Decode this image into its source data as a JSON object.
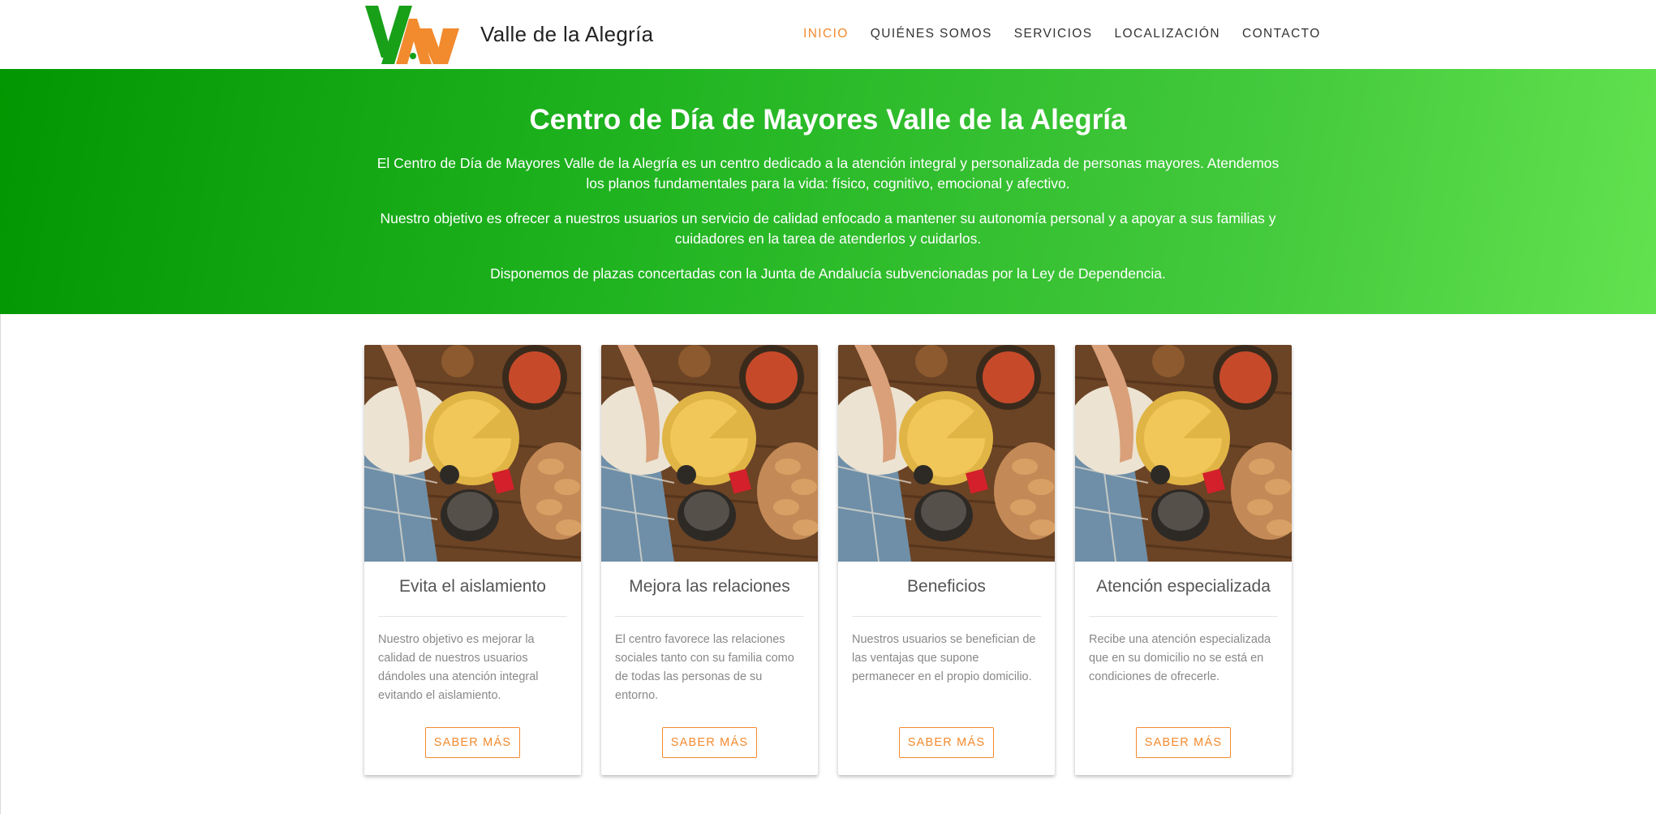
{
  "header": {
    "brand": "Valle de la Alegría",
    "logo_icon": "valle-alegria-va-logo",
    "nav": [
      "INICIO",
      "QUIÉNES SOMOS",
      "SERVICIOS",
      "LOCALIZACIÓN",
      "CONTACTO"
    ],
    "active_nav": "INICIO"
  },
  "hero": {
    "title": "Centro de Día de Mayores Valle de la Alegría",
    "p1": "El Centro de Día de Mayores Valle de la Alegría es un centro dedicado a la atención integral y personalizada de personas mayores. Atendemos los planos fundamentales para la vida: físico, cognitivo, emocional y afectivo.",
    "p2": "Nuestro objetivo es ofrecer a nuestros usuarios un servicio de calidad enfocado a mantener su autonomía personal y a apoyar a sus familias y cuidadores en la tarea de atenderlos y cuidarlos.",
    "p3": "Disponemos de plazas concertadas con la Junta de Andalucía subvencionadas por la Ley de Dependencia."
  },
  "cards": [
    {
      "title": "Evita el aislamiento",
      "text": "Nuestro objetivo es mejorar la calidad de nuestros usuarios dándoles una atención integral evitando el aislamiento.",
      "button": "SABER MÁS"
    },
    {
      "title": "Mejora las relaciones",
      "text": "El centro favorece las relaciones sociales tanto con su familia como de todas las personas de su entorno.",
      "button": "SABER MÁS"
    },
    {
      "title": "Beneficios",
      "text": "Nuestros usuarios se benefician de las ventajas que supone permanecer en el propio domicilio.",
      "button": "SABER MÁS"
    },
    {
      "title": "Atención especializada",
      "text": "Recibe una atención especializada que en su domicilio no se está en condiciones de ofrecerle.",
      "button": "SABER MÁS"
    }
  ],
  "colors": {
    "accent_orange": "#f28a2e",
    "hero_green_start": "#029702",
    "hero_green_end": "#62e24f"
  }
}
